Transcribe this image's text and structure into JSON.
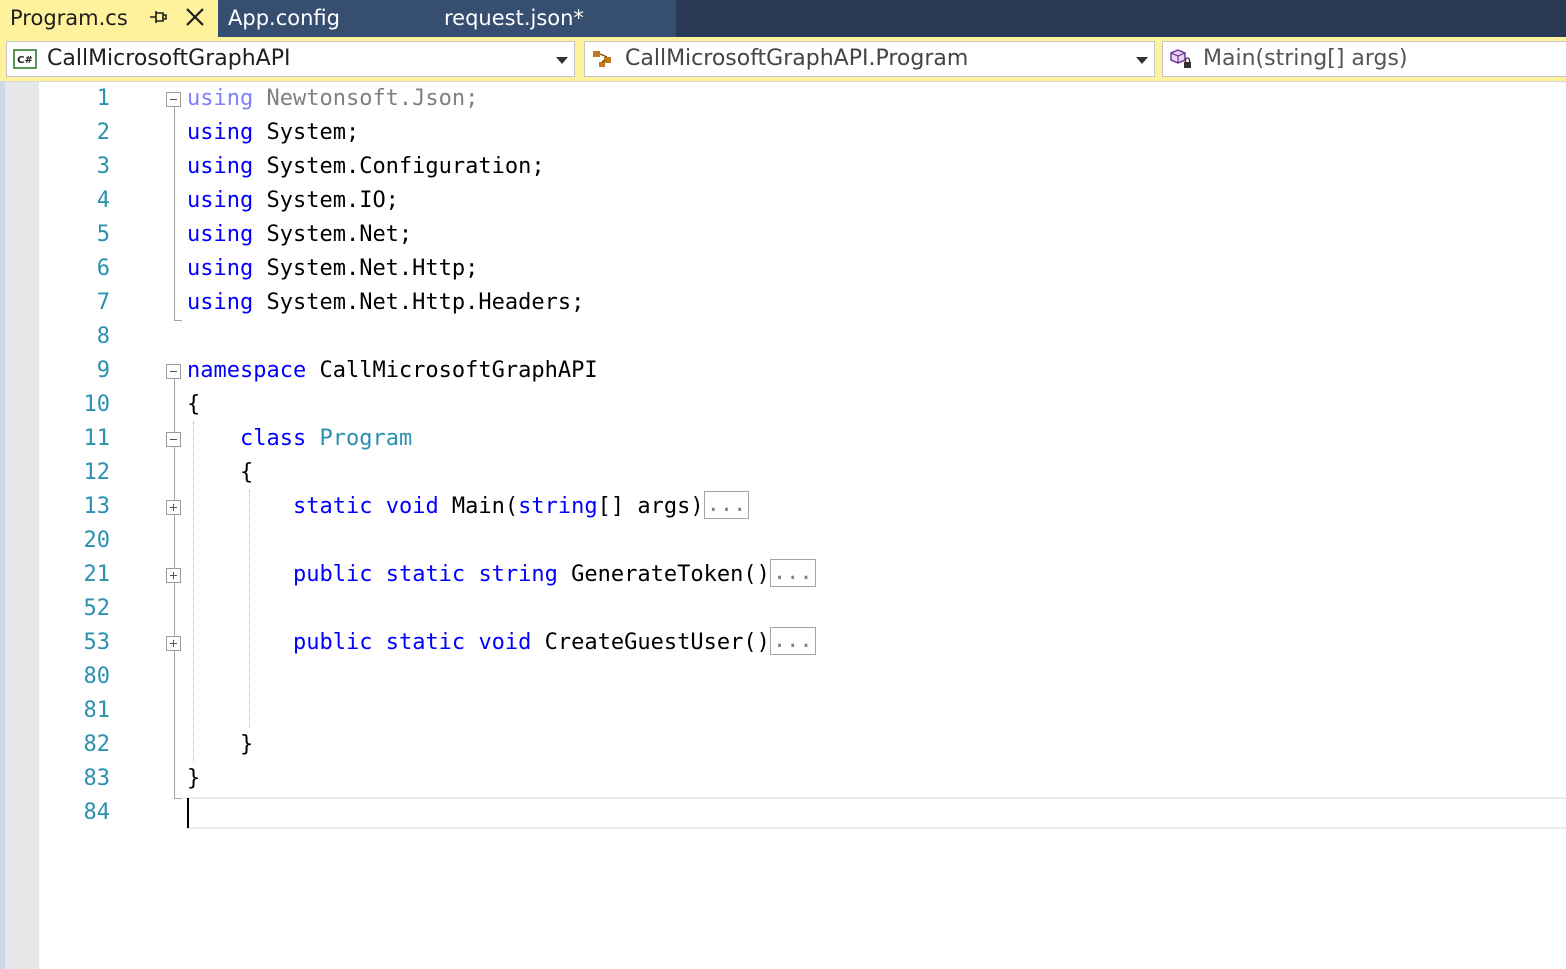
{
  "tabs": [
    {
      "label": "Program.cs",
      "active": true
    },
    {
      "label": "App.config",
      "active": false
    },
    {
      "label": "request.json*",
      "active": false
    }
  ],
  "navbar": {
    "project": "CallMicrosoftGraphAPI",
    "type": "CallMicrosoftGraphAPI.Program",
    "member": "Main(string[] args)"
  },
  "line_numbers": [
    "1",
    "2",
    "3",
    "4",
    "5",
    "6",
    "7",
    "8",
    "9",
    "10",
    "11",
    "12",
    "13",
    "20",
    "21",
    "52",
    "53",
    "80",
    "81",
    "82",
    "83",
    "84"
  ],
  "code": {
    "l1": {
      "kw": "using",
      "rest": " Newtonsoft.Json;"
    },
    "l2": {
      "kw": "using",
      "rest": " System;"
    },
    "l3": {
      "kw": "using",
      "rest": " System.Configuration;"
    },
    "l4": {
      "kw": "using",
      "rest": " System.IO;"
    },
    "l5": {
      "kw": "using",
      "rest": " System.Net;"
    },
    "l6": {
      "kw": "using",
      "rest": " System.Net.Http;"
    },
    "l7": {
      "kw": "using",
      "rest": " System.Net.Http.Headers;"
    },
    "l9": {
      "kw": "namespace",
      "rest": " CallMicrosoftGraphAPI"
    },
    "l10": "{",
    "l11": {
      "indent": "    ",
      "kw": "class",
      "sp": " ",
      "type": "Program"
    },
    "l12": "    {",
    "l13": {
      "indent": "        ",
      "kw1": "static",
      "kw2": "void",
      "name": " Main(",
      "kw3": "string",
      "rest": "[] args)",
      "collapsed": "..."
    },
    "l21": {
      "indent": "        ",
      "kw1": "public",
      "kw2": "static",
      "kw3": "string",
      "rest": " GenerateToken()",
      "collapsed": "..."
    },
    "l53": {
      "indent": "        ",
      "kw1": "public",
      "kw2": "static",
      "kw3": "void",
      "rest": " CreateGuestUser()",
      "collapsed": "..."
    },
    "l82": "    }",
    "l83": "}"
  },
  "colors": {
    "tab_active_bg": "#fff29d",
    "tab_strip_bg": "#293955",
    "keyword": "#0000ff",
    "type_name": "#2b91af",
    "line_number": "#2b91af"
  }
}
